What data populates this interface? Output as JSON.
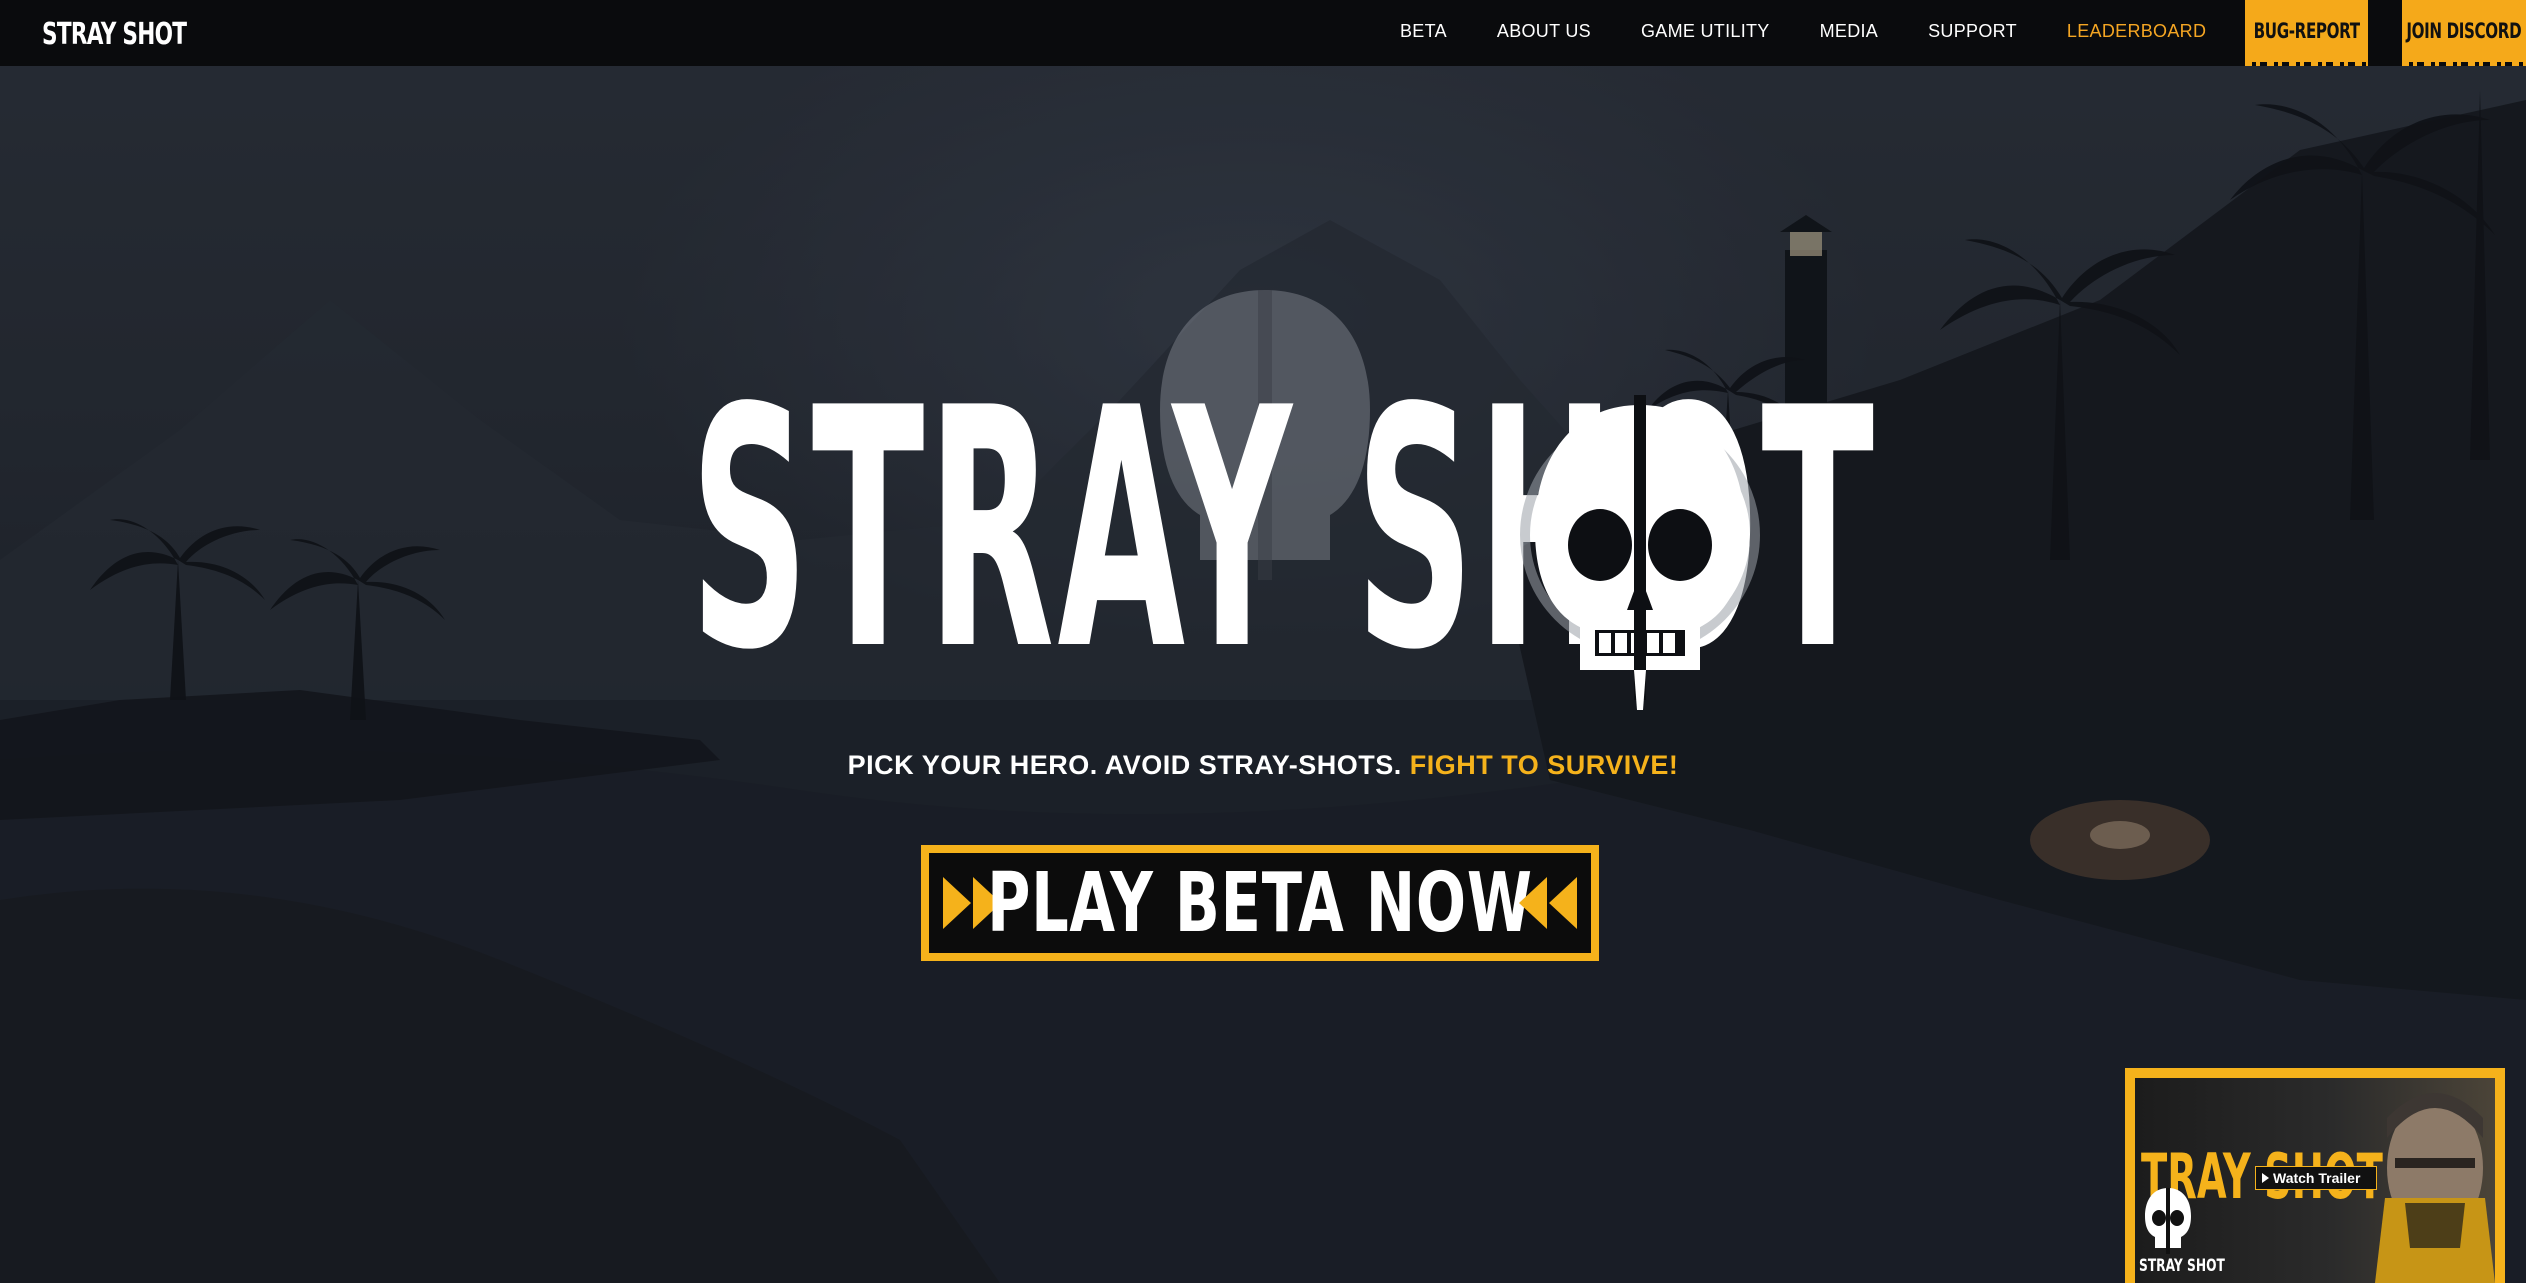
{
  "brand": {
    "logo_text": "STRAY SHOT"
  },
  "nav": {
    "links": [
      {
        "label": "BETA"
      },
      {
        "label": "ABOUT US"
      },
      {
        "label": "GAME UTILITY"
      },
      {
        "label": "MEDIA"
      },
      {
        "label": "SUPPORT"
      },
      {
        "label": "LEADERBOARD"
      }
    ],
    "bug_report_label": "BUG-REPORT",
    "discord_label": "JOIN DISCORD"
  },
  "hero": {
    "logo_text": "STRAY SHOT",
    "tagline_main": "PICK YOUR HERO. AVOID STRAY-SHOTS.",
    "tagline_highlight": "FIGHT TO SURVIVE!",
    "cta_label": "PLAY BETA NOW"
  },
  "trailer": {
    "title_text": "TRAY SHOT",
    "watch_label": "Watch Trailer",
    "brand_text": "STRAY SHOT"
  },
  "colors": {
    "accent": "#f5b21b",
    "nav_bg": "#0a0b0d",
    "highlight_link": "#f5a623"
  },
  "icons": [
    "skull-logo-icon",
    "play-icon",
    "arrow-right-icon",
    "arrow-left-icon"
  ]
}
